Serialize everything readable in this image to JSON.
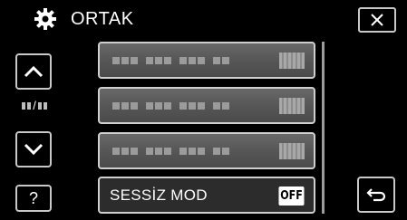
{
  "header": {
    "title": "ORTAK",
    "settings_icon": "gear-icon",
    "close_icon": "close-icon"
  },
  "side": {
    "up_icon": "chevron-up-icon",
    "down_icon": "chevron-down-icon",
    "page_indicator_sep": "/",
    "help_label": "?"
  },
  "menu": {
    "items": [
      {
        "label": "",
        "value": "",
        "obscured": true
      },
      {
        "label": "",
        "value": "",
        "obscured": true
      },
      {
        "label": "",
        "value": "",
        "obscured": true
      },
      {
        "label": "SESSİZ MOD",
        "value": "OFF",
        "obscured": false
      }
    ]
  },
  "footer": {
    "back_icon": "return-icon"
  },
  "colors": {
    "background": "#000000",
    "border": "#cfcfcf",
    "item_bg": "#4a4a4a",
    "badge_bg": "#ffffff"
  }
}
